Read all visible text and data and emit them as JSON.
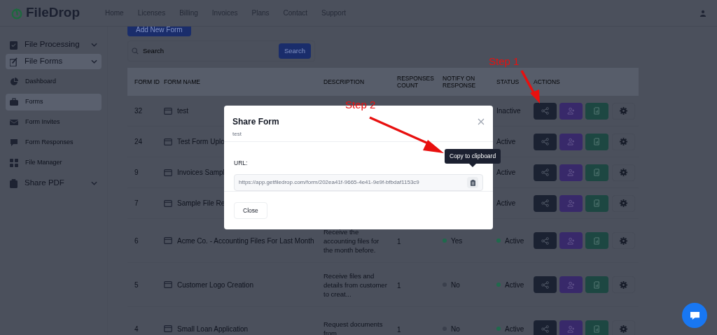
{
  "brand": "FileDrop",
  "nav": [
    {
      "label": "Home"
    },
    {
      "label": "Licenses"
    },
    {
      "label": "Billing"
    },
    {
      "label": "Invoices"
    },
    {
      "label": "Plans"
    },
    {
      "label": "Contact"
    },
    {
      "label": "Support"
    }
  ],
  "sidebar": {
    "items": [
      {
        "label": "File Processing",
        "kind": "group",
        "selected": false
      },
      {
        "label": "File Forms",
        "kind": "group",
        "selected": true,
        "children": [
          {
            "label": "Dashboard",
            "kind": "dashboard",
            "selected": false
          },
          {
            "label": "Forms",
            "kind": "forms",
            "selected": true
          },
          {
            "label": "Form Invites",
            "kind": "invites",
            "selected": false
          },
          {
            "label": "Form Responses",
            "kind": "responses",
            "selected": false
          },
          {
            "label": "File Manager",
            "kind": "manager",
            "selected": false
          }
        ]
      },
      {
        "label": "Share PDF",
        "kind": "group",
        "selected": false
      }
    ]
  },
  "add_button": "Add New Form",
  "search": {
    "placeholder": "Search",
    "button": "Search"
  },
  "table": {
    "columns": [
      "FORM ID",
      "FORM NAME",
      "DESCRIPTION",
      "RESPONSES COUNT",
      "NOTIFY ON RESPONSE",
      "STATUS",
      "ACTIONS"
    ],
    "rows": [
      {
        "id": "32",
        "name": "test",
        "status": "Inactive"
      },
      {
        "id": "24",
        "name": "Test Form Uplo",
        "status": "Active"
      },
      {
        "id": "9",
        "name": "Invoices Sampl",
        "status": "Active"
      },
      {
        "id": "7",
        "name": "Sample File Re",
        "status": "Active"
      },
      {
        "id": "6",
        "name": "Acme Co. - Accounting Files For Last Month",
        "description": "Receive the accounting files for the month before.",
        "responses": "1",
        "notify": "Yes",
        "notify_on": true,
        "status": "Active",
        "active": true
      },
      {
        "id": "5",
        "name": "Customer Logo Creation",
        "description": "Receive files and details from customer to creat...",
        "responses": "1",
        "notify": "No",
        "notify_on": false,
        "status": "Active",
        "active": true
      },
      {
        "id": "4",
        "name": "Small Loan Application",
        "description": "Request documents from",
        "responses": "1",
        "notify": "No",
        "notify_on": false,
        "status": "Active",
        "active": true
      }
    ]
  },
  "modal": {
    "title": "Share Form",
    "subtitle": "test",
    "url_label": "URL:",
    "url": "https://app.getfiledrop.com/form/202ea41f-9665-4e41-9e9f-bfbdaf1153c9",
    "tooltip": "Copy to clipboard",
    "close_button": "Close"
  },
  "annotations": [
    {
      "text": "Step 1"
    },
    {
      "text": "Step 2"
    }
  ]
}
